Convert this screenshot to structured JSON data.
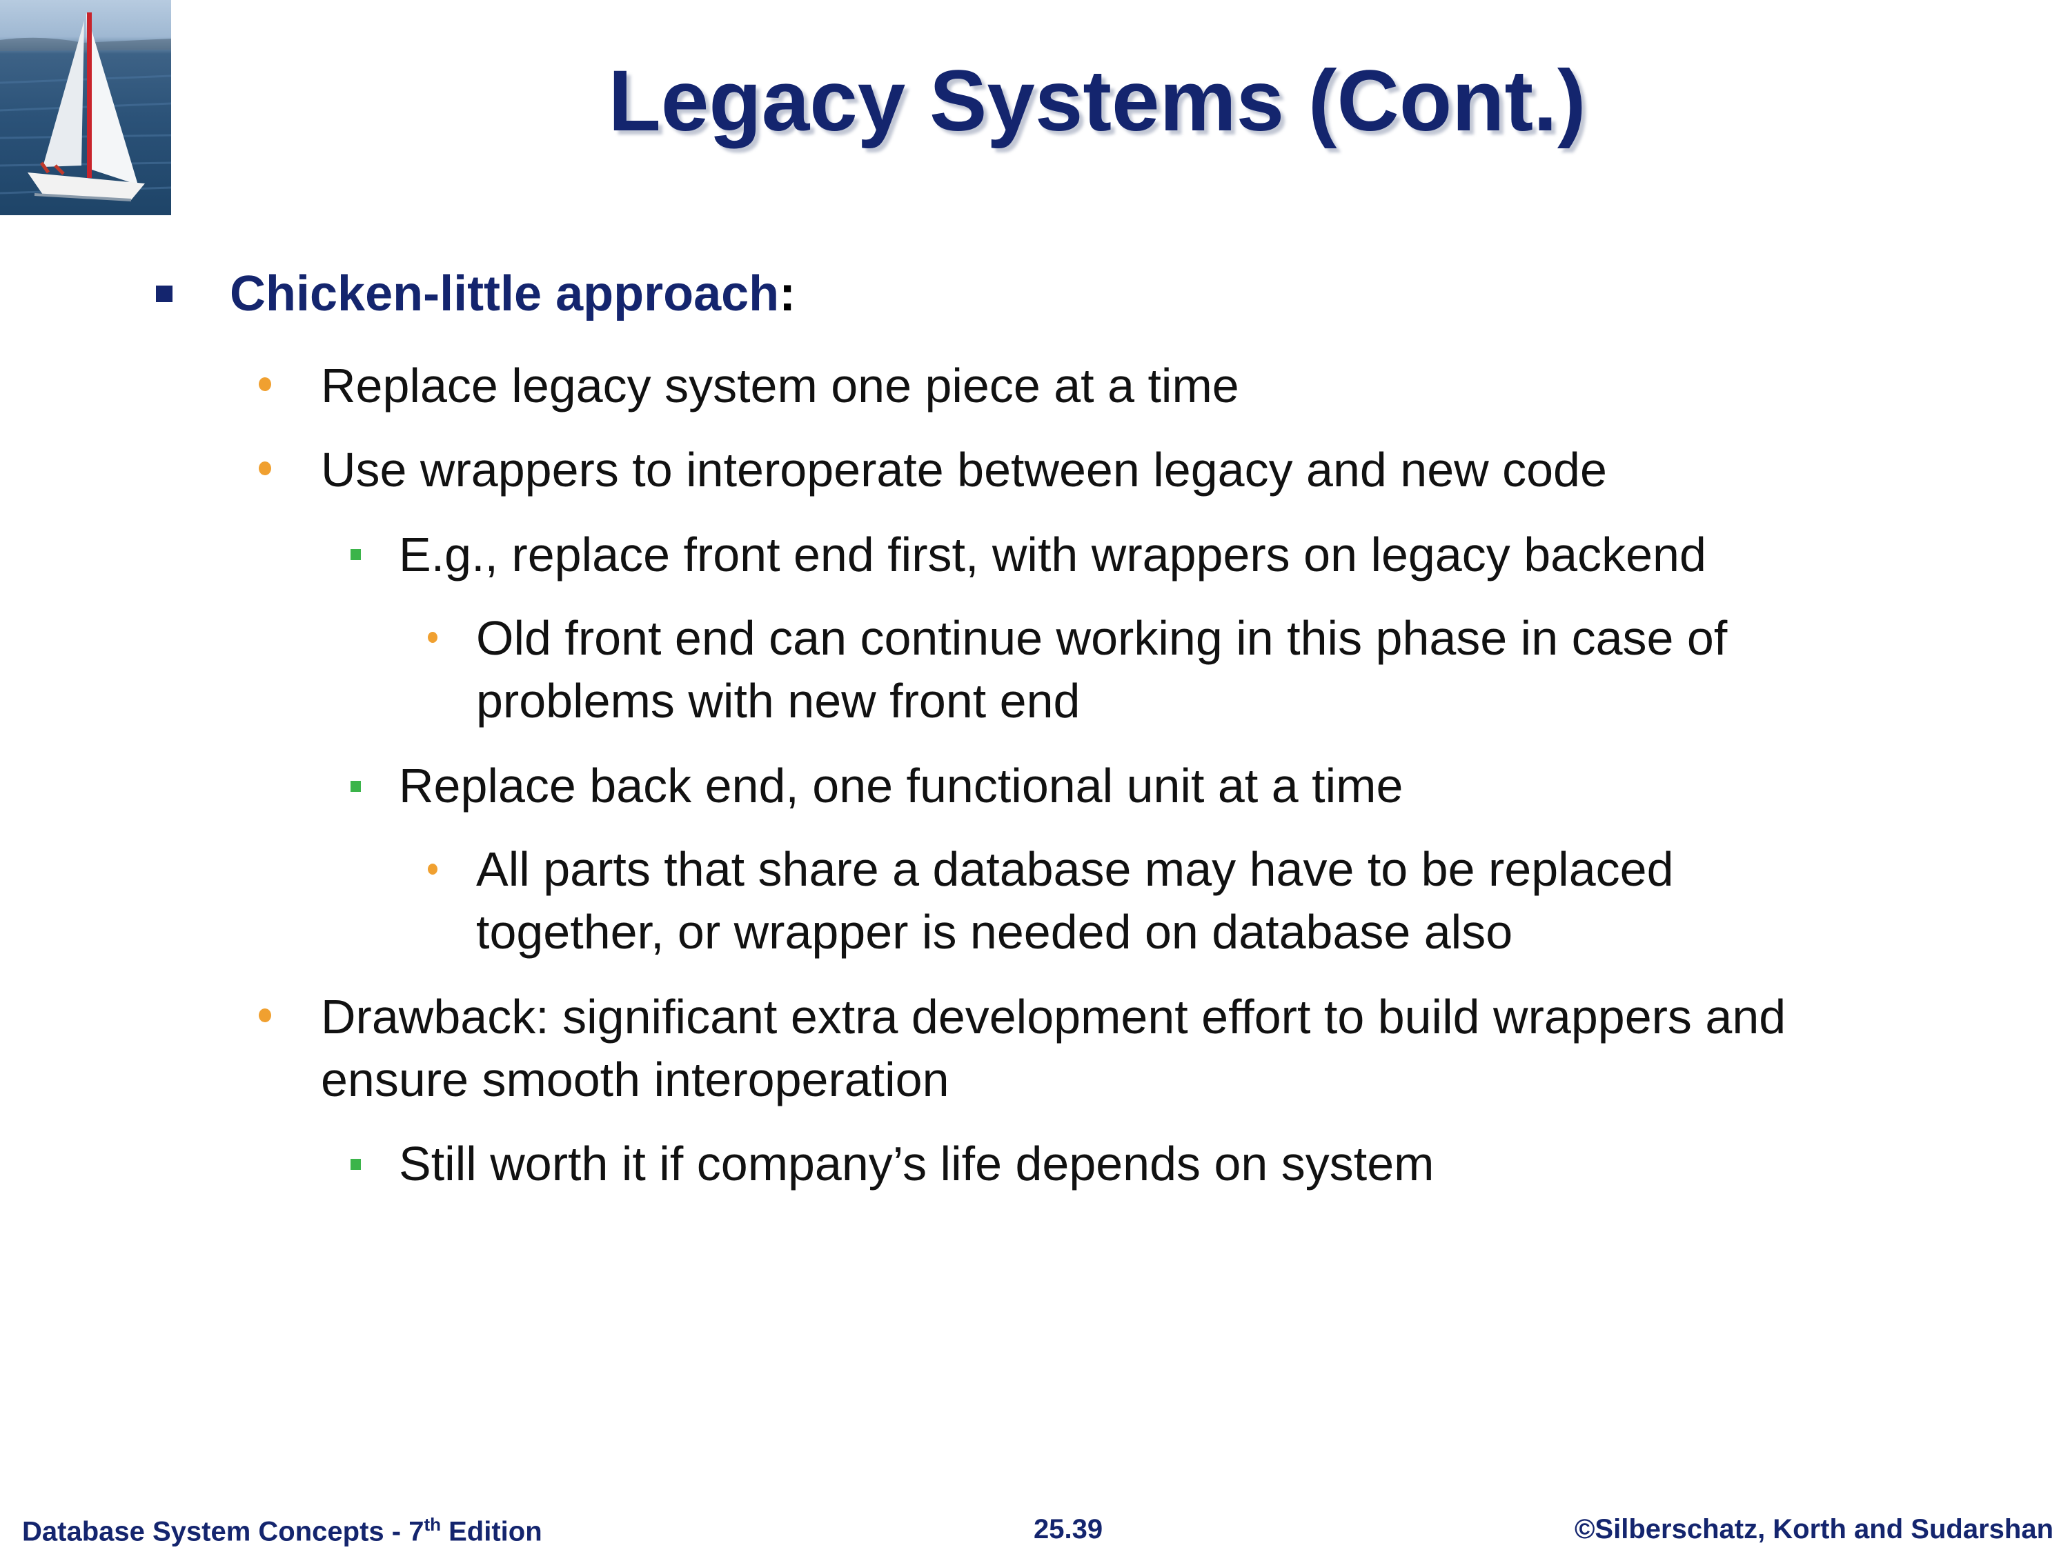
{
  "slide": {
    "title": "Legacy Systems (Cont.)",
    "heading": {
      "text": "Chicken-little approach",
      "colon": ":"
    },
    "bullets": [
      {
        "text": "Replace legacy system one piece at a time"
      },
      {
        "text": "Use wrappers to interoperate between legacy and new code"
      },
      {
        "text": "E.g., replace front end first, with wrappers on legacy backend"
      },
      {
        "line1": "Old front end can continue working in this phase in case of",
        "line2": "problems with new front end"
      },
      {
        "text": "Replace back end, one functional unit at a time"
      },
      {
        "line1": "All parts that share a database may have to be replaced",
        "line2": "together, or wrapper is needed on database also"
      },
      {
        "line1": "Drawback:  significant extra development effort to build wrappers and",
        "line2": "ensure smooth interoperation"
      },
      {
        "text": "Still worth it if company’s life depends on system"
      }
    ]
  },
  "footer": {
    "left_pre": "Database System Concepts - 7",
    "left_sup": "th",
    "left_post": " Edition",
    "center": "25.39",
    "right": "©Silberschatz, Korth and Sudarshan"
  },
  "colors": {
    "title": "#14256e",
    "orange_bullet": "#f0a030",
    "green_bullet": "#3bb44a",
    "navy_bullet": "#14256e"
  }
}
